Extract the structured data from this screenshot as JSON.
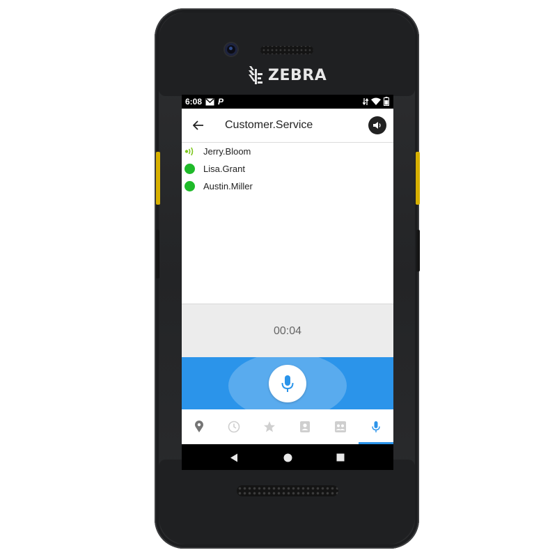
{
  "device": {
    "brand": "ZEBRA"
  },
  "status_bar": {
    "time": "6:08",
    "notification_icons": [
      "mail-icon",
      "p-app-icon"
    ],
    "p_glyph": "P",
    "system_icons": [
      "data-arrows-icon",
      "wifi-icon",
      "battery-icon"
    ]
  },
  "app_bar": {
    "title": "Customer.Service",
    "back_icon": "arrow-left-icon",
    "volume_icon": "speaker-icon"
  },
  "members": [
    {
      "name": "Jerry.Bloom",
      "status": "talking",
      "icon": "talking-wave-icon"
    },
    {
      "name": "Lisa.Grant",
      "status": "online",
      "icon": "green-dot-icon"
    },
    {
      "name": "Austin.Miller",
      "status": "online",
      "icon": "green-dot-icon"
    }
  ],
  "call": {
    "timer": "00:04",
    "ptt_icon": "microphone-icon"
  },
  "tabs": [
    {
      "icon": "location-pin-icon",
      "active": false
    },
    {
      "icon": "clock-icon",
      "active": false
    },
    {
      "icon": "star-icon",
      "active": false
    },
    {
      "icon": "contacts-icon",
      "active": false
    },
    {
      "icon": "groups-icon",
      "active": false
    },
    {
      "icon": "microphone-icon",
      "active": true
    }
  ],
  "nav_bar": [
    "back-triangle-icon",
    "home-circle-icon",
    "recents-square-icon"
  ],
  "colors": {
    "accent_blue": "#2b94ea",
    "online_green": "#1fba29",
    "talking_green": "#7cc61c",
    "device_body": "#232426",
    "side_key_yellow": "#d7b000"
  }
}
